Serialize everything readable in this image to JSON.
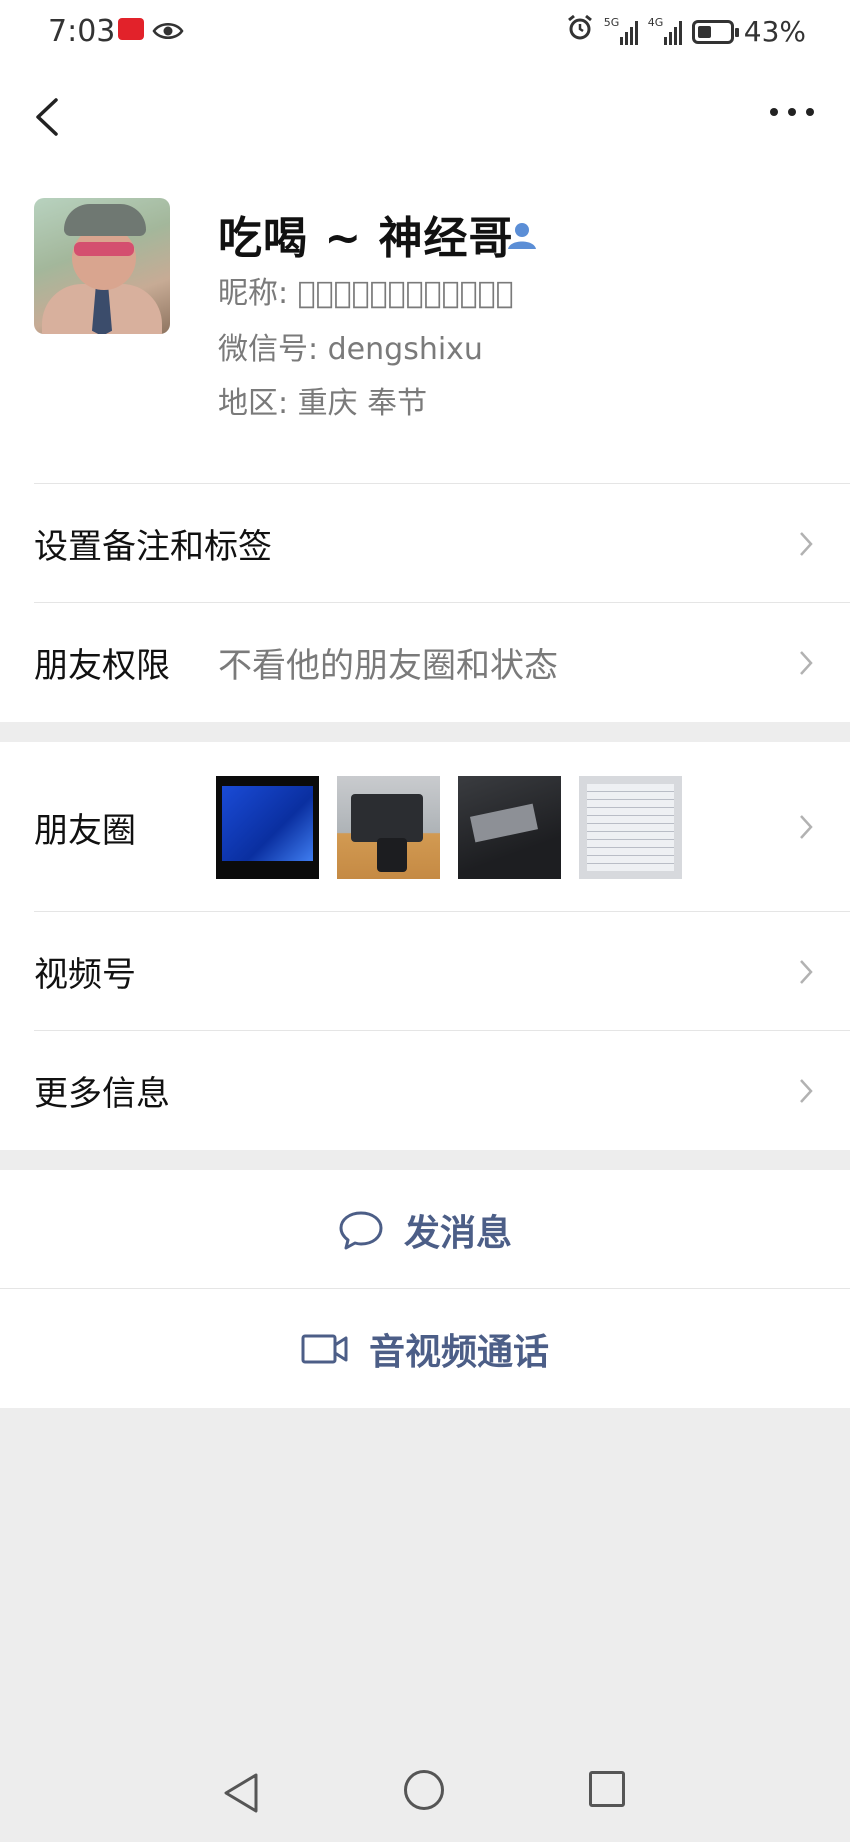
{
  "status_bar": {
    "time": "7:03",
    "network_1": "5G",
    "network_2": "4G",
    "battery_percent": "43%",
    "battery_level": 0.43
  },
  "profile": {
    "name": "吃喝 ~ 神经哥",
    "nickname_text": "昵称: 抓͛狂͛的͛神͛经͛哥͛",
    "wechat_id_text": "微信号: dengshixu",
    "region_text": "地区: 重庆  奉节"
  },
  "rows": {
    "remarks_label": "设置备注和标签",
    "permissions_label": "朋友权限",
    "permissions_value": "不看他的朋友圈和状态",
    "moments_label": "朋友圈",
    "channels_label": "视频号",
    "more_info_label": "更多信息"
  },
  "actions": {
    "message_label": "发消息",
    "call_label": "音视频通话"
  },
  "colors": {
    "accent_text": "#4c5e87",
    "background": "#ededed"
  }
}
